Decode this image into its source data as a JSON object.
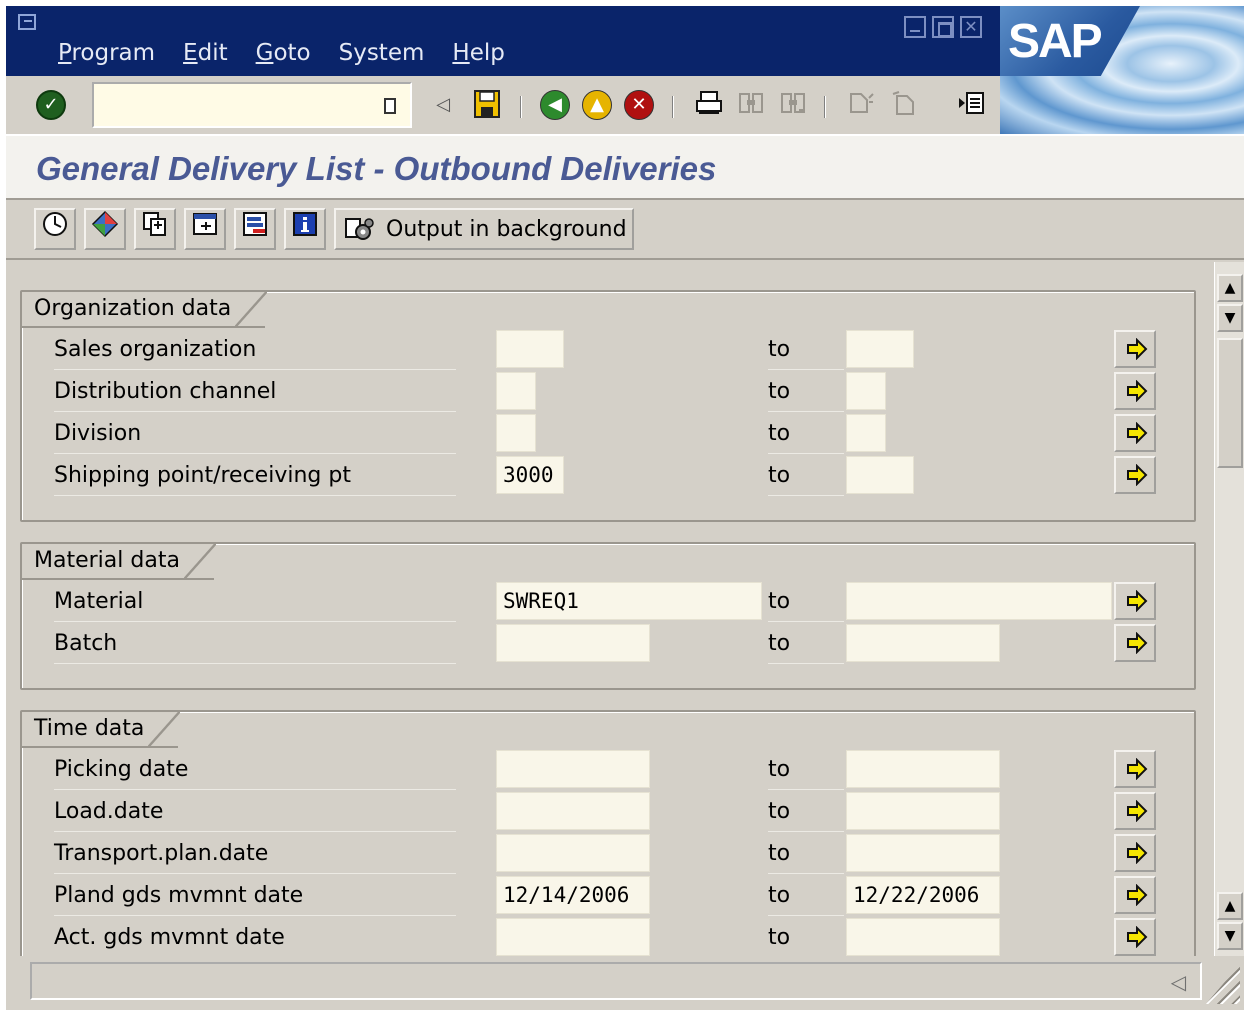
{
  "menu": {
    "items": [
      {
        "mnemonic": "P",
        "rest": "rogram"
      },
      {
        "mnemonic": "E",
        "rest": "dit"
      },
      {
        "mnemonic": "G",
        "rest": "oto"
      },
      {
        "mnemonic": "",
        "rest": "System"
      },
      {
        "mnemonic": "H",
        "rest": "elp"
      }
    ]
  },
  "brand": {
    "logo_text": "SAP"
  },
  "command_field": {
    "value": ""
  },
  "page_title": "General Delivery List - Outbound Deliveries",
  "app_toolbar": {
    "output_background_label": "Output in background"
  },
  "groups": {
    "organization": {
      "title": "Organization data",
      "rows": [
        {
          "label": "Sales organization",
          "from": "",
          "to_label": "to",
          "to": ""
        },
        {
          "label": "Distribution channel",
          "from": "",
          "to_label": "to",
          "to": ""
        },
        {
          "label": "Division",
          "from": "",
          "to_label": "to",
          "to": ""
        },
        {
          "label": "Shipping point/receiving pt",
          "from": "3000",
          "to_label": "to",
          "to": ""
        }
      ]
    },
    "material": {
      "title": "Material data",
      "rows": [
        {
          "label": "Material",
          "from": "SWREQ1",
          "to_label": "to",
          "to": ""
        },
        {
          "label": "Batch",
          "from": "",
          "to_label": "to",
          "to": ""
        }
      ]
    },
    "time": {
      "title": "Time data",
      "rows": [
        {
          "label": "Picking date",
          "from": "",
          "to_label": "to",
          "to": ""
        },
        {
          "label": "Load.date",
          "from": "",
          "to_label": "to",
          "to": ""
        },
        {
          "label": "Transport.plan.date",
          "from": "",
          "to_label": "to",
          "to": ""
        },
        {
          "label": "Pland gds mvmnt date",
          "from": "12/14/2006",
          "to_label": "to",
          "to": "12/22/2006"
        },
        {
          "label": "Act. gds mvmnt date",
          "from": "",
          "to_label": "to",
          "to": ""
        }
      ]
    }
  },
  "status": {
    "text": ""
  },
  "colors": {
    "menubar": "#0a246a",
    "title_text": "#4a5a94",
    "input_bg": "#f9f6e9",
    "window_bg": "#d4d0c8",
    "more_arrow": "#f5e600"
  },
  "icons": [
    "window-menu-icon",
    "minimize-icon",
    "maximize-icon",
    "close-icon",
    "enter-check-icon",
    "history-dropdown-icon",
    "back-triangle-icon",
    "save-icon",
    "back-icon",
    "exit-icon",
    "cancel-icon",
    "print-icon",
    "find-icon",
    "find-next-icon",
    "first-page-icon",
    "last-page-icon",
    "create-session-icon",
    "execute-icon",
    "get-variant-icon",
    "copy-icon",
    "dynamic-selections-icon",
    "layout-icon",
    "info-icon",
    "background-output-icon",
    "multiple-selection-arrow-icon"
  ]
}
